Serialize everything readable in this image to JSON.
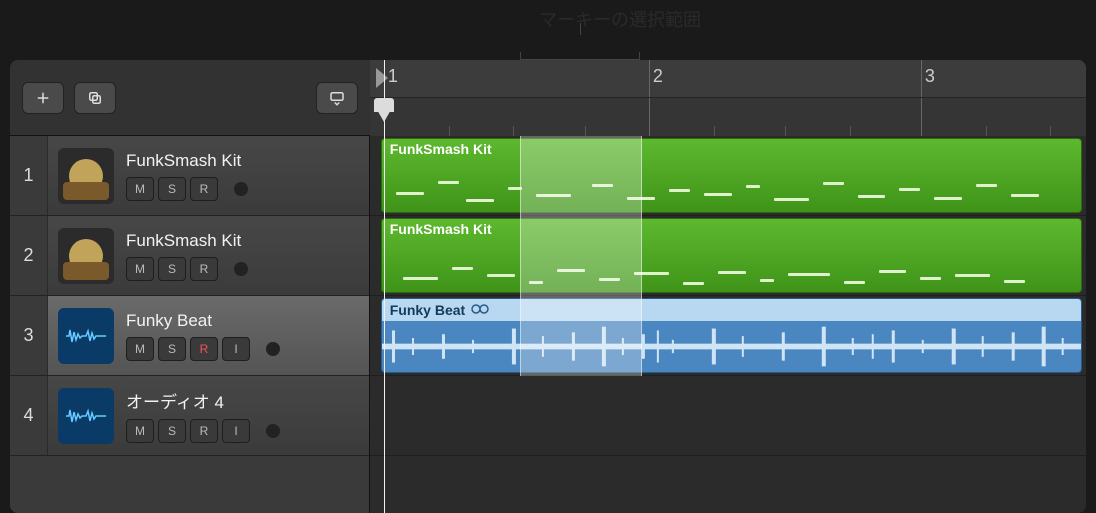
{
  "annotation": {
    "label": "マーキーの選択範囲"
  },
  "ruler": {
    "bars": [
      {
        "label": "1",
        "left_pct": 2
      },
      {
        "label": "2",
        "left_pct": 39
      },
      {
        "label": "3",
        "left_pct": 77
      }
    ]
  },
  "playhead": {
    "left_pct": 2
  },
  "marquee": {
    "left_pct": 21,
    "width_pct": 17
  },
  "toolbar": {
    "add": "+",
    "duplicate": "⧉",
    "collapse": "▾"
  },
  "tracks": [
    {
      "index": "1",
      "name": "FunkSmash Kit",
      "type": "midi",
      "selected": false,
      "buttons": [
        "M",
        "S",
        "R"
      ],
      "rec_armed": false,
      "region": {
        "title": "FunkSmash Kit",
        "left_pct": 1.5,
        "width_pct": 98
      }
    },
    {
      "index": "2",
      "name": "FunkSmash Kit",
      "type": "midi",
      "selected": false,
      "buttons": [
        "M",
        "S",
        "R"
      ],
      "rec_armed": false,
      "region": {
        "title": "FunkSmash Kit",
        "left_pct": 1.5,
        "width_pct": 98
      }
    },
    {
      "index": "3",
      "name": "Funky Beat",
      "type": "audio",
      "selected": true,
      "buttons": [
        "M",
        "S",
        "R",
        "I"
      ],
      "rec_armed": true,
      "region": {
        "title": "Funky Beat",
        "left_pct": 1.5,
        "width_pct": 98
      }
    },
    {
      "index": "4",
      "name": "オーディオ 4",
      "type": "audio",
      "selected": false,
      "buttons": [
        "M",
        "S",
        "R",
        "I"
      ],
      "rec_armed": false,
      "region": null
    }
  ]
}
